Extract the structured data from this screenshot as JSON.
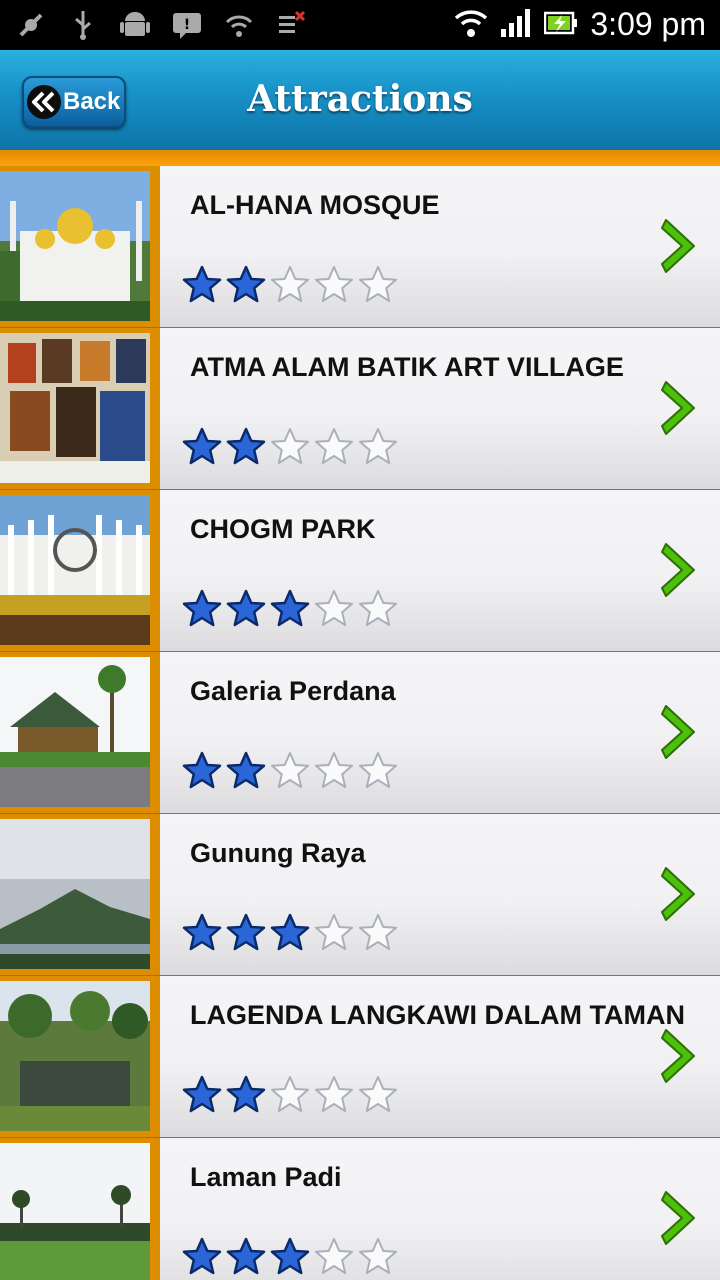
{
  "status_bar": {
    "time": "3:09 pm"
  },
  "header": {
    "title": "Attractions",
    "back_label": "Back"
  },
  "colors": {
    "header_blue": "#1790c6",
    "accent_orange": "#f39800",
    "star_blue": "#2a66d8",
    "chevron_green": "#3fae00"
  },
  "rating_max": 5,
  "attractions": [
    {
      "name": "AL-HANA MOSQUE",
      "rating": 2
    },
    {
      "name": "ATMA ALAM BATIK ART VILLAGE",
      "rating": 2
    },
    {
      "name": "CHOGM PARK",
      "rating": 3
    },
    {
      "name": "Galeria Perdana",
      "rating": 2
    },
    {
      "name": "Gunung Raya",
      "rating": 3
    },
    {
      "name": "LAGENDA LANGKAWI DALAM TAMAN",
      "rating": 2
    },
    {
      "name": "Laman Padi",
      "rating": 3
    }
  ]
}
